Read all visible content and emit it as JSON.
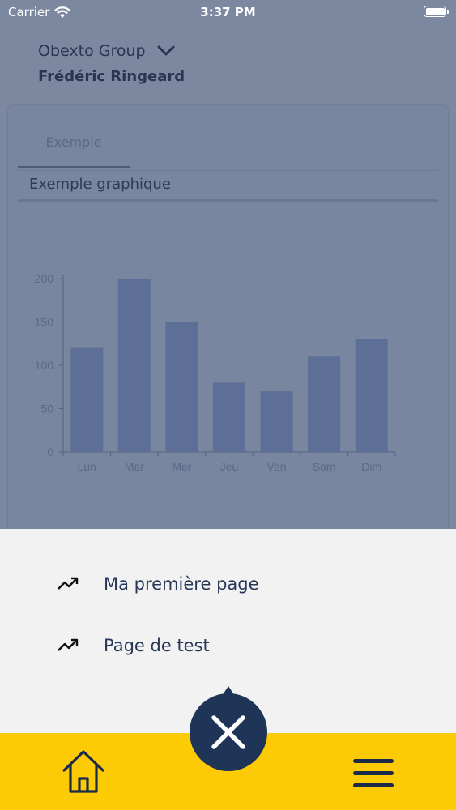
{
  "status_bar": {
    "carrier": "Carrier",
    "time": "3:37 PM"
  },
  "header": {
    "company": "Obexto Group",
    "user": "Frédéric Ringeard"
  },
  "tabs": [
    {
      "label": "Exemple"
    }
  ],
  "chart_data": {
    "type": "bar",
    "title": "Exemple graphique",
    "categories": [
      "Lun",
      "Mar",
      "Mer",
      "Jeu",
      "Ven",
      "Sam",
      "Dim"
    ],
    "values": [
      120,
      200,
      150,
      80,
      70,
      110,
      130
    ],
    "ylim": [
      0,
      200
    ],
    "yticks": [
      "0",
      "50",
      "100",
      "150",
      "200"
    ],
    "grid": false,
    "bar_color": "#5d6f96"
  },
  "menu": {
    "items": [
      {
        "label": "Ma première page",
        "icon": "trending-up-icon"
      },
      {
        "label": "Page de test",
        "icon": "trending-up-icon"
      }
    ]
  },
  "bottom_bar": {
    "home_icon": "home-icon",
    "menu_icon": "hamburger-icon",
    "close_icon": "close-icon"
  },
  "colors": {
    "accent": "#fccb06",
    "dark": "#1f3558",
    "overlay": "#7b88a0"
  }
}
